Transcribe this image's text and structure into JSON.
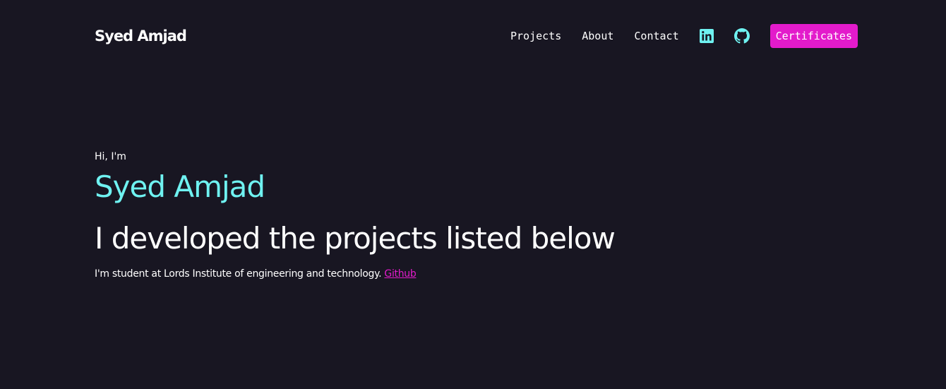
{
  "header": {
    "brand": "Syed Amjad",
    "nav": [
      {
        "label": "Projects"
      },
      {
        "label": "About"
      },
      {
        "label": "Contact"
      }
    ],
    "icons": [
      "linkedin-icon",
      "github-icon"
    ],
    "cta_label": "Certificates"
  },
  "hero": {
    "greeting": "Hi, I'm",
    "name": "Syed Amjad",
    "headline": "I developed the projects listed below",
    "bio_text": "I'm student at Lords Institute of engineering and technology.",
    "bio_link_label": "Github"
  },
  "colors": {
    "background": "#181622",
    "accent_cyan": "#6ff2f1",
    "accent_magenta": "#e31bcb",
    "text": "#ffffff"
  }
}
